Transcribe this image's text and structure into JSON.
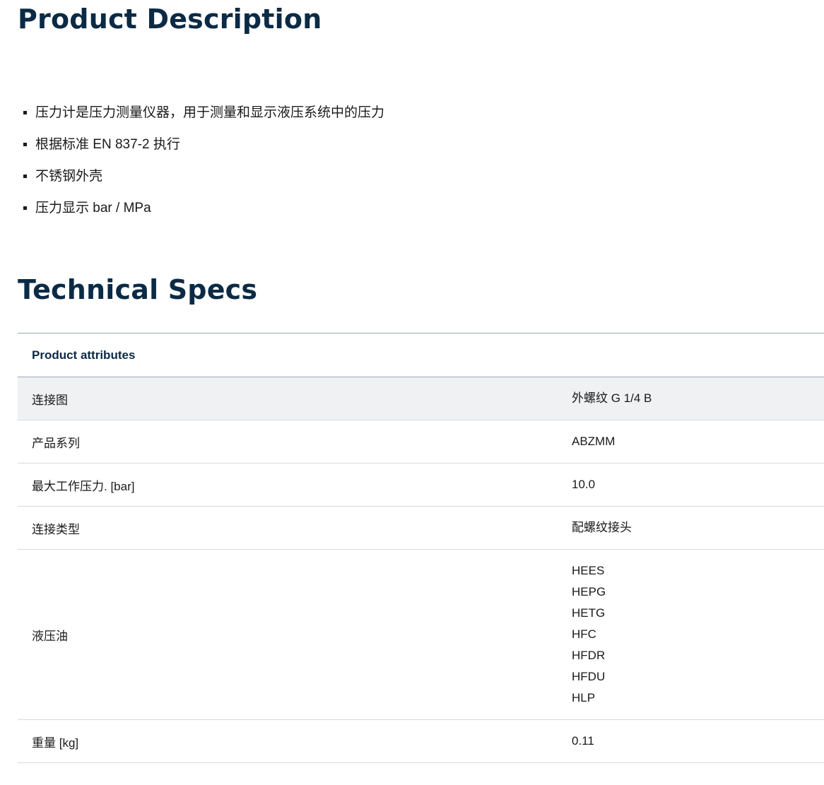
{
  "description": {
    "title": "Product Description",
    "bullets": [
      "压力计是压力测量仪器，用于测量和显示液压系统中的压力",
      "根据标准 EN 837-2 执行",
      "不锈钢外壳",
      "压力显示 bar / MPa"
    ]
  },
  "specs": {
    "title": "Technical Specs",
    "table_header": "Product attributes",
    "rows": [
      {
        "label": "连接图",
        "values": [
          "外螺纹 G 1/4 B"
        ]
      },
      {
        "label": "产品系列",
        "values": [
          "ABZMM"
        ]
      },
      {
        "label": "最大工作压力. [bar]",
        "values": [
          "10.0"
        ]
      },
      {
        "label": "连接类型",
        "values": [
          "配螺纹接头"
        ]
      },
      {
        "label": "液压油",
        "values": [
          "HEES",
          "HEPG",
          "HETG",
          "HFC",
          "HFDR",
          "HFDU",
          "HLP"
        ]
      },
      {
        "label": "重量 [kg]",
        "values": [
          "0.11"
        ]
      }
    ]
  },
  "colors": {
    "heading": "#0b2a45",
    "row_shade": "#eff1f2",
    "divider": "#d6dbe0"
  }
}
